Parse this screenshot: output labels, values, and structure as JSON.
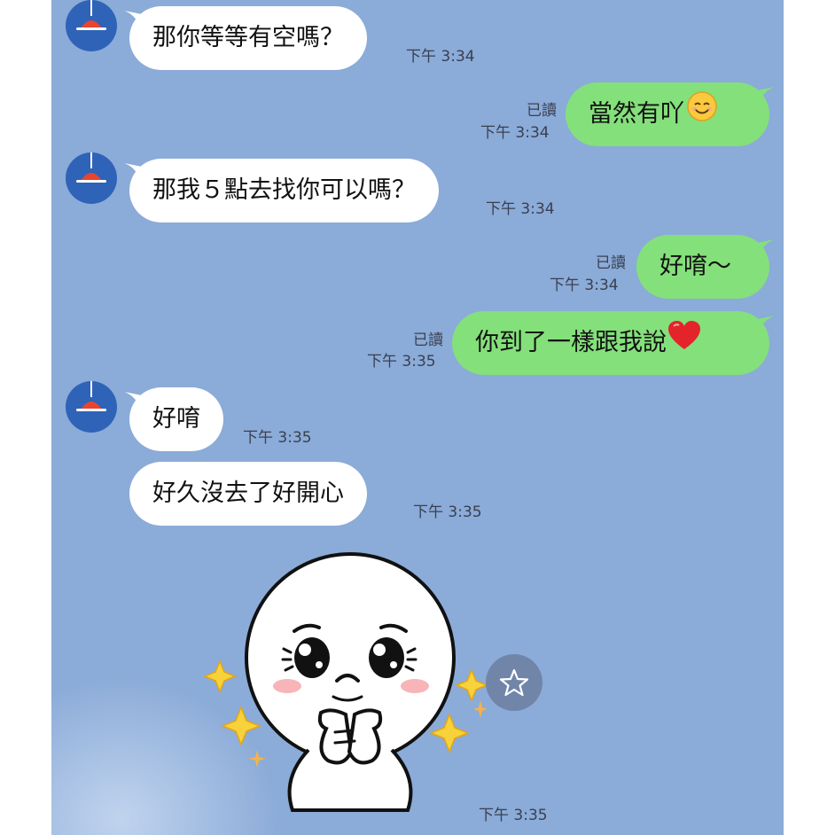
{
  "messages": [
    {
      "side": "in",
      "text": "那你等等有空嗎？",
      "time": "下午 3:34"
    },
    {
      "side": "out",
      "text": "當然有吖",
      "read": "已讀",
      "time": "下午 3:34",
      "emoji": "smile-emoji"
    },
    {
      "side": "in",
      "text": "那我５點去找你可以嗎？",
      "time": "下午 3:34"
    },
    {
      "side": "out",
      "text": "好唷～",
      "read": "已讀",
      "time": "下午 3:34"
    },
    {
      "side": "out",
      "text": "你到了一樣跟我說",
      "read": "已讀",
      "time": "下午 3:35",
      "emoji": "heart-emoji"
    },
    {
      "side": "in",
      "text": "好唷",
      "time": "下午 3:35"
    },
    {
      "side": "in",
      "text": "好久沒去了好開心",
      "time": "下午 3:35"
    },
    {
      "side": "in",
      "type": "sticker",
      "sticker": "hopeful-moon-sticker",
      "time": "下午 3:35"
    }
  ],
  "colors": {
    "background": "#8babd8",
    "incoming": "#ffffff",
    "outgoing": "#84e07a",
    "avatar": "#2e63b8"
  },
  "icons": {
    "avatar": "lamp-avatar-icon",
    "favorite": "star-icon"
  }
}
